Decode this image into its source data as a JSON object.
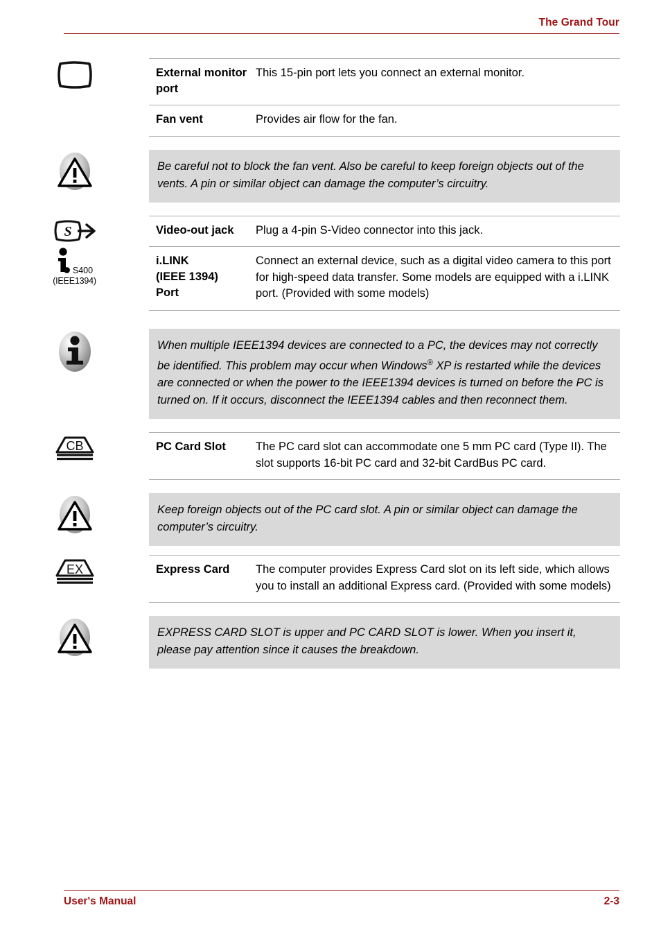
{
  "header": {
    "title": "The Grand Tour"
  },
  "footer": {
    "manual_label": "User's Manual",
    "page_number": "2-3"
  },
  "colors": {
    "accent_red": "#9e1313",
    "callout_background": "#d9d9d9",
    "rule_gray": "#a9a9a9"
  },
  "blocks": [
    {
      "kind": "spec-group",
      "icon": "external-monitor-port-icon",
      "rows": [
        {
          "term": "External monitor port",
          "desc": "This 15-pin port lets you connect an external monitor."
        },
        {
          "term": "Fan vent",
          "desc": "Provides air flow for the fan."
        }
      ]
    },
    {
      "kind": "callout",
      "icon": "warning-triangle-icon",
      "text": "Be careful not to block the fan vent. Also be careful to keep foreign objects out of the vents. A pin or similar object can damage the computer’s circuitry."
    },
    {
      "kind": "spec-group",
      "icon": "s-video-out-icon",
      "rows": [
        {
          "term": "Video-out jack",
          "desc": "Plug a 4-pin S-Video connector into this jack."
        }
      ]
    },
    {
      "kind": "spec-group",
      "icon": "ilink-icon",
      "icon_text": {
        "speed": "S400",
        "standard": "(IEEE1394)"
      },
      "rows": [
        {
          "term": "i.LINK (IEEE 1394) Port",
          "term_line_1": "i.LINK",
          "term_line_2": "(IEEE 1394)",
          "term_line_3": "Port",
          "desc": "Connect an external device, such as a digital video camera to this port for high-speed data transfer. Some models are equipped with a i.LINK port. (Provided with some models)"
        }
      ]
    },
    {
      "kind": "callout",
      "icon": "info-circle-icon",
      "text_part_1": "When multiple IEEE1394 devices are connected to a PC, the devices may not correctly be identified. This problem may occur when Windows",
      "text_superscript": "®",
      "text_part_2": " XP is restarted while the devices are connected or when the power to the IEEE1394 devices is turned on before the PC is turned on. If it occurs, disconnect the IEEE1394 cables and then reconnect them."
    },
    {
      "kind": "spec-group",
      "icon": "cardbus-slot-icon",
      "icon_text": "CB",
      "rows": [
        {
          "term": "PC Card Slot",
          "desc": "The PC card slot can accommodate one 5 mm PC card (Type II). The slot supports 16-bit PC card and 32-bit CardBus PC card."
        }
      ]
    },
    {
      "kind": "callout",
      "icon": "warning-triangle-icon",
      "text": "Keep foreign objects out of the PC card slot. A pin or similar object can damage the computer’s circuitry."
    },
    {
      "kind": "spec-group",
      "icon": "express-card-slot-icon",
      "icon_text": "EX",
      "rows": [
        {
          "term": "Express Card",
          "desc": "The computer provides Express Card slot on its left side, which allows you to install an additional Express card. (Provided with some models)"
        }
      ]
    },
    {
      "kind": "callout",
      "icon": "warning-triangle-icon",
      "text": "EXPRESS CARD SLOT is upper and PC CARD SLOT is lower. When you insert it, please pay attention since it causes the breakdown."
    }
  ]
}
